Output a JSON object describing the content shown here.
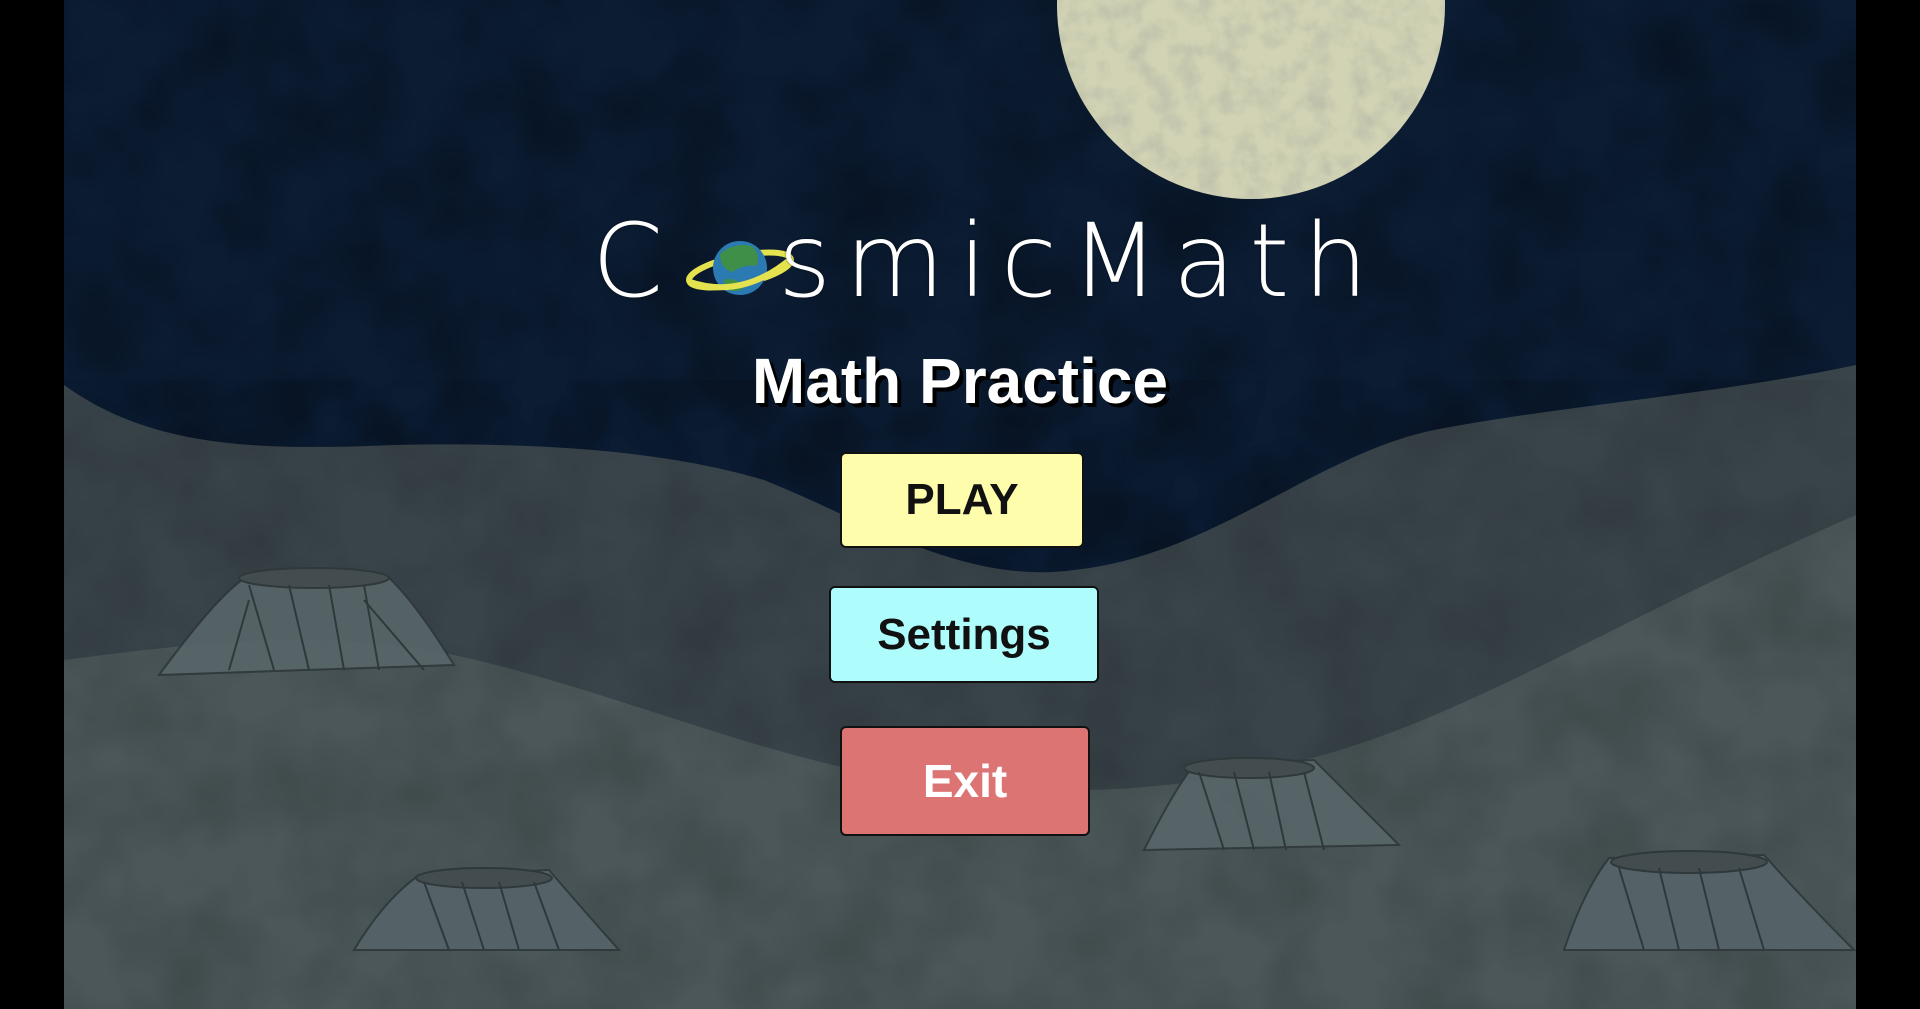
{
  "title": {
    "logo_first_letter": "C",
    "logo_rest": "smicMath",
    "subtitle": "Math Practice"
  },
  "icons": {
    "logo_o": "ringed-planet-icon"
  },
  "menu": {
    "play_label": "PLAY",
    "settings_label": "Settings",
    "exit_label": "Exit"
  },
  "colors": {
    "sky": "#0b1c33",
    "hills_far": "#39444a",
    "hills_near": "#4b5759",
    "moon": "#d2d3b4",
    "play_button": "#fdfdab",
    "settings_button": "#aefcfc",
    "exit_button": "#dd7474",
    "planet_ocean": "#2b7ab1",
    "planet_land": "#3f8f48",
    "planet_ring": "#e4e24f"
  }
}
